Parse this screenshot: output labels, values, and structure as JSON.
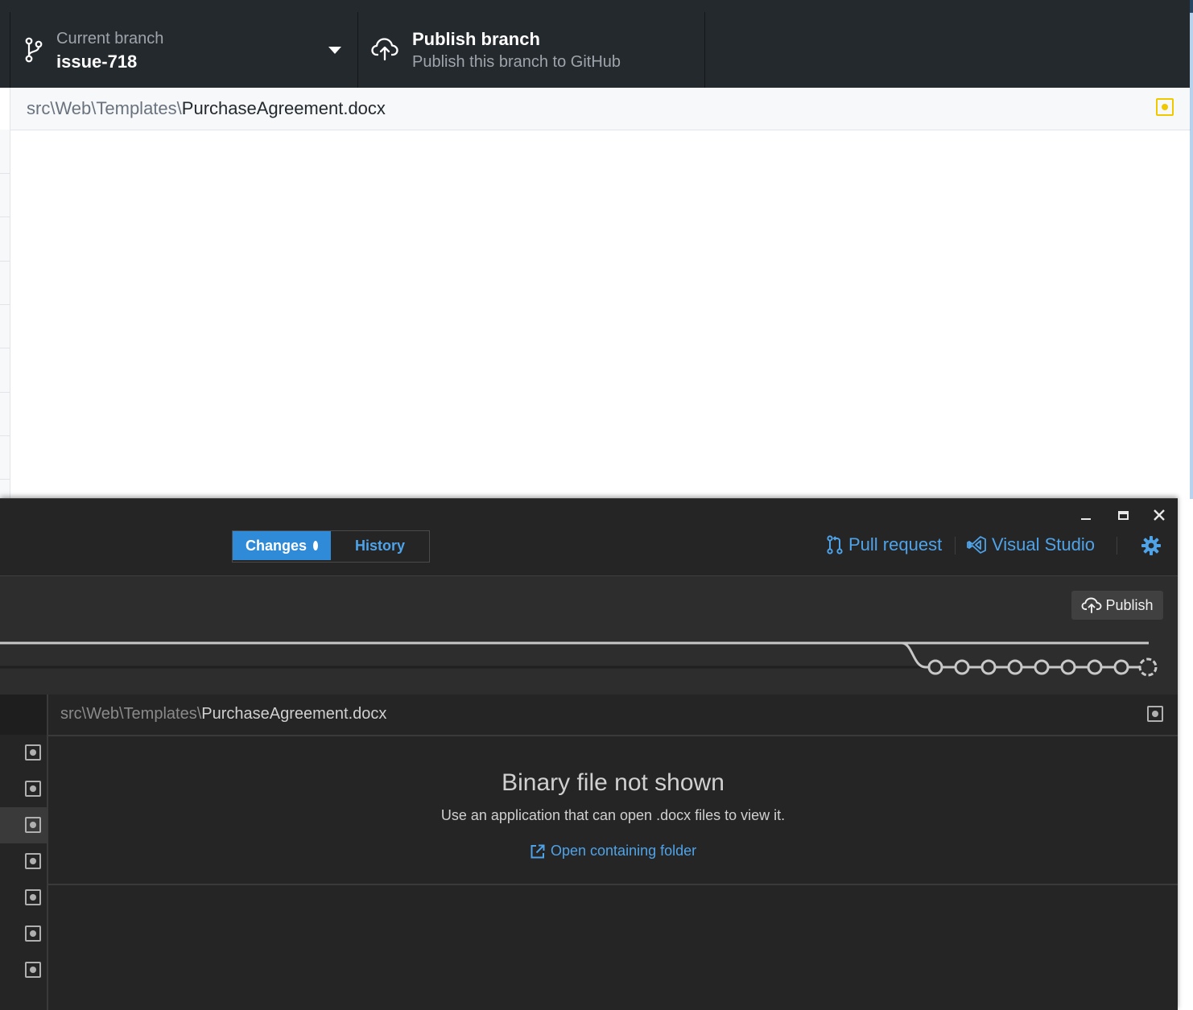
{
  "background_window": {
    "current_branch_label": "Current branch",
    "branch_name": "issue-718",
    "publish_title": "Publish branch",
    "publish_subtitle": "Publish this branch to GitHub",
    "file_path_dir": "src\\Web\\Templates\\",
    "file_path_name": "PurchaseAgreement.docx",
    "file_status": "modified"
  },
  "foreground_window": {
    "tabs": [
      {
        "label": "Changes",
        "active": true,
        "has_indicator": true
      },
      {
        "label": "History",
        "active": false
      }
    ],
    "toolbar": {
      "pull_request_label": "Pull request",
      "visual_studio_label": "Visual Studio",
      "settings_icon": "gear-icon"
    },
    "branch_bar": {
      "publish_button_label": "Publish",
      "commit_node_count": 9
    },
    "file_list": {
      "items": [
        {
          "status": "modified",
          "selected": false
        },
        {
          "status": "modified",
          "selected": false
        },
        {
          "status": "modified",
          "selected": true
        },
        {
          "status": "modified",
          "selected": false
        },
        {
          "status": "modified",
          "selected": false
        },
        {
          "status": "modified",
          "selected": false
        },
        {
          "status": "modified",
          "selected": false
        }
      ]
    },
    "diff": {
      "file_path_dir": "src\\Web\\Templates\\",
      "file_path_name": "PurchaseAgreement.docx",
      "message_title": "Binary file not shown",
      "message_body": "Use an application that can open .docx files to view it.",
      "open_folder_label": "Open containing folder"
    }
  },
  "colors": {
    "accent_blue": "#2f8ad8",
    "link_blue": "#4fa3e8",
    "modified_yellow": "#f0c800",
    "dark_bg": "#252526",
    "toolbar_dark": "#24292e"
  }
}
